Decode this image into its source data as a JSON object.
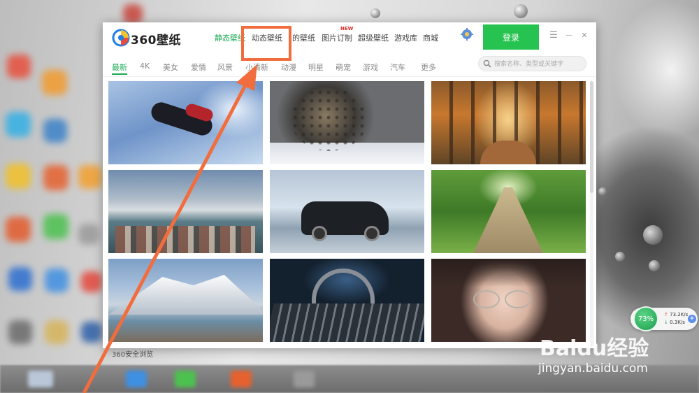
{
  "window": {
    "brand": "360壁纸",
    "nav": [
      {
        "label": "静态壁纸",
        "active": true
      },
      {
        "label": "动态壁纸",
        "active": false
      },
      {
        "label": "的壁纸",
        "active": false
      },
      {
        "label": "图片订制",
        "active": false,
        "badge": "NEW"
      },
      {
        "label": "超级壁纸",
        "active": false
      },
      {
        "label": "游戏库",
        "active": false
      },
      {
        "label": "商城",
        "active": false
      }
    ],
    "login_label": "登录",
    "controls": {
      "menu": "☰",
      "minimize": "—",
      "close": "✕"
    }
  },
  "categories": [
    {
      "label": "最新",
      "active": true
    },
    {
      "label": "4K"
    },
    {
      "label": "美女"
    },
    {
      "label": "爱情"
    },
    {
      "label": "风景"
    },
    {
      "label": "小清新"
    },
    {
      "label": "动漫"
    },
    {
      "label": "明星"
    },
    {
      "label": "萌宠"
    },
    {
      "label": "游戏"
    },
    {
      "label": "汽车"
    },
    {
      "label": "更多"
    }
  ],
  "search": {
    "placeholder": "搜索名称、类型或关键字"
  },
  "wallpapers": [
    {
      "subject": "spider-man-jumping"
    },
    {
      "subject": "snow-leopard"
    },
    {
      "subject": "autumn-forest-path"
    },
    {
      "subject": "foggy-town-coast"
    },
    {
      "subject": "rally-car-on-ice"
    },
    {
      "subject": "wooden-path-grass"
    },
    {
      "subject": "snowy-mountain-lake"
    },
    {
      "subject": "headphones-mixer"
    },
    {
      "subject": "girl-with-glasses"
    }
  ],
  "taskbar": {
    "label": "360安全浏览"
  },
  "speed_widget": {
    "percent": "73%",
    "upload": "73.2K/s",
    "download": "0.3K/s"
  },
  "watermark": {
    "logo": "Baidu经验",
    "url": "jingyan.baidu.com"
  },
  "annotation": {
    "highlight_target": "动态壁纸",
    "color": "#f26d3d"
  },
  "colors": {
    "accent": "#1aaa55",
    "login": "#27c350"
  }
}
